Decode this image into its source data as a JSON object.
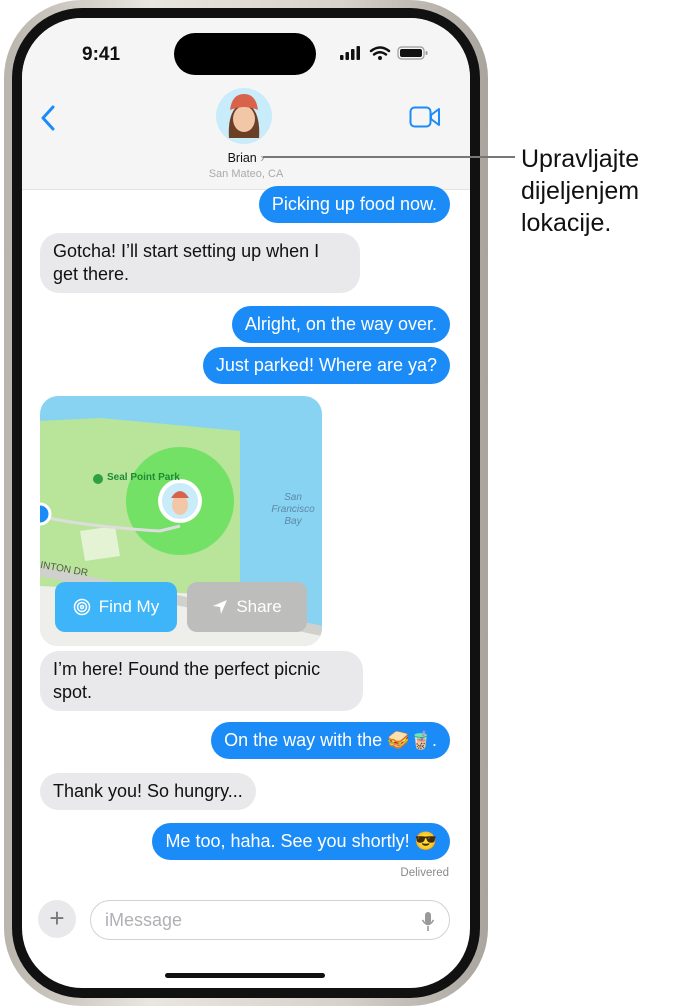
{
  "status_bar": {
    "time": "9:41"
  },
  "header": {
    "contact_name": "Brian",
    "contact_location": "San Mateo, CA"
  },
  "messages": [
    {
      "dir": "out",
      "text": "Picking up food now."
    },
    {
      "dir": "in",
      "text": "Gotcha! I’ll start setting up when I get there."
    },
    {
      "dir": "out",
      "text": "Alright, on the way over."
    },
    {
      "dir": "out",
      "text": "Just parked! Where are ya?"
    },
    {
      "dir": "in",
      "text": "I’m here! Found the perfect picnic spot."
    },
    {
      "dir": "out",
      "text": "On the way with the 🥪🧋."
    },
    {
      "dir": "in",
      "text": "Thank you! So hungry..."
    },
    {
      "dir": "out",
      "text": "Me too, haha. See you shortly! 😎"
    }
  ],
  "map": {
    "park_label": "Seal Point Park",
    "bay_label": "San Francisco Bay",
    "street_label": "INTON DR",
    "find_my_label": "Find My",
    "share_label": "Share"
  },
  "delivered": "Delivered",
  "input": {
    "placeholder": "iMessage"
  },
  "annotation": "Upravljajte dijeljenjem lokacije.",
  "colors": {
    "accent": "#1b8cf7",
    "incoming": "#e9e9eb"
  }
}
